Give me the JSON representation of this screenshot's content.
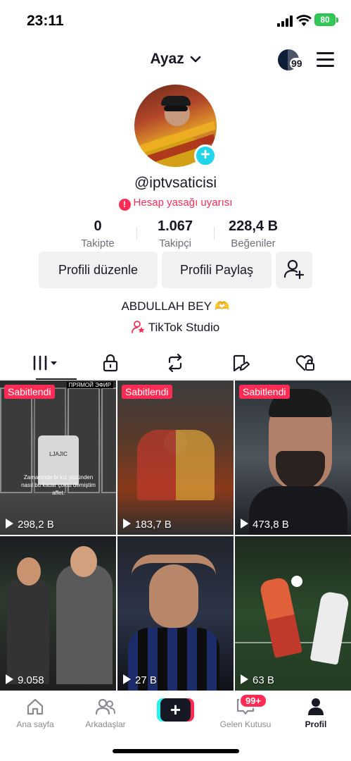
{
  "status_bar": {
    "time": "23:11",
    "battery": "80"
  },
  "header": {
    "account_name": "Ayaz",
    "notifications_badge": "99"
  },
  "profile": {
    "username": "@iptvsaticisi",
    "warning": "Hesap yasağı uyarısı",
    "stats": [
      {
        "value": "0",
        "label": "Takipte"
      },
      {
        "value": "1.067",
        "label": "Takipçi"
      },
      {
        "value": "228,4 B",
        "label": "Beğeniler"
      }
    ],
    "buttons": {
      "edit": "Profili düzenle",
      "share": "Profili Paylaş"
    },
    "bio": "ABDULLAH BEY 🫶",
    "studio_link": "TikTok Studio"
  },
  "tabs": [
    {
      "icon": "grid-icon",
      "active": true
    },
    {
      "icon": "lock-icon",
      "active": false
    },
    {
      "icon": "repost-icon",
      "active": false
    },
    {
      "icon": "favorites-icon",
      "active": false
    },
    {
      "icon": "liked-icon",
      "active": false
    }
  ],
  "videos": [
    {
      "pinned": "Sabitlendi",
      "views": "298,2 B",
      "caption": "Zamanında bi kız yüzünden nasıl bu kadar çöktü demiştim affet.",
      "overlay": "ПРЯМОЙ ЭФИР",
      "jersey": "LJAJIC"
    },
    {
      "pinned": "Sabitlendi",
      "views": "183,7 B"
    },
    {
      "pinned": "Sabitlendi",
      "views": "473,8 B"
    },
    {
      "views": "9.058"
    },
    {
      "views": "27 B"
    },
    {
      "views": "63 B"
    }
  ],
  "bottom_nav": {
    "home": "Ana sayfa",
    "friends": "Arkadaşlar",
    "inbox": "Gelen Kutusu",
    "inbox_badge": "99+",
    "profile": "Profil"
  },
  "colors": {
    "accent": "#fe2c55",
    "cyan": "#25f4ee",
    "text": "#161823",
    "muted": "#6f7079"
  }
}
